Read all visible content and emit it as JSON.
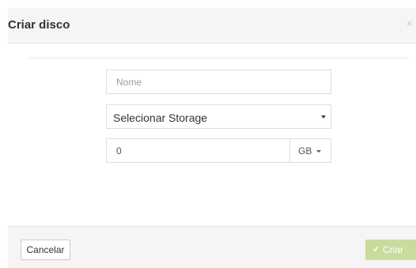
{
  "dialog": {
    "title": "Criar disco",
    "close_glyph": "×"
  },
  "form": {
    "name": {
      "value": "",
      "placeholder": "Nome"
    },
    "storage": {
      "selected": "Selecionar Storage"
    },
    "size": {
      "value": "0",
      "unit": "GB"
    }
  },
  "footer": {
    "cancel_label": "Cancelar",
    "create_label": "Criar",
    "create_icon": "check-icon"
  },
  "colors": {
    "header_bg": "#f5f5f5",
    "create_button_disabled": "#c9dc9e"
  }
}
